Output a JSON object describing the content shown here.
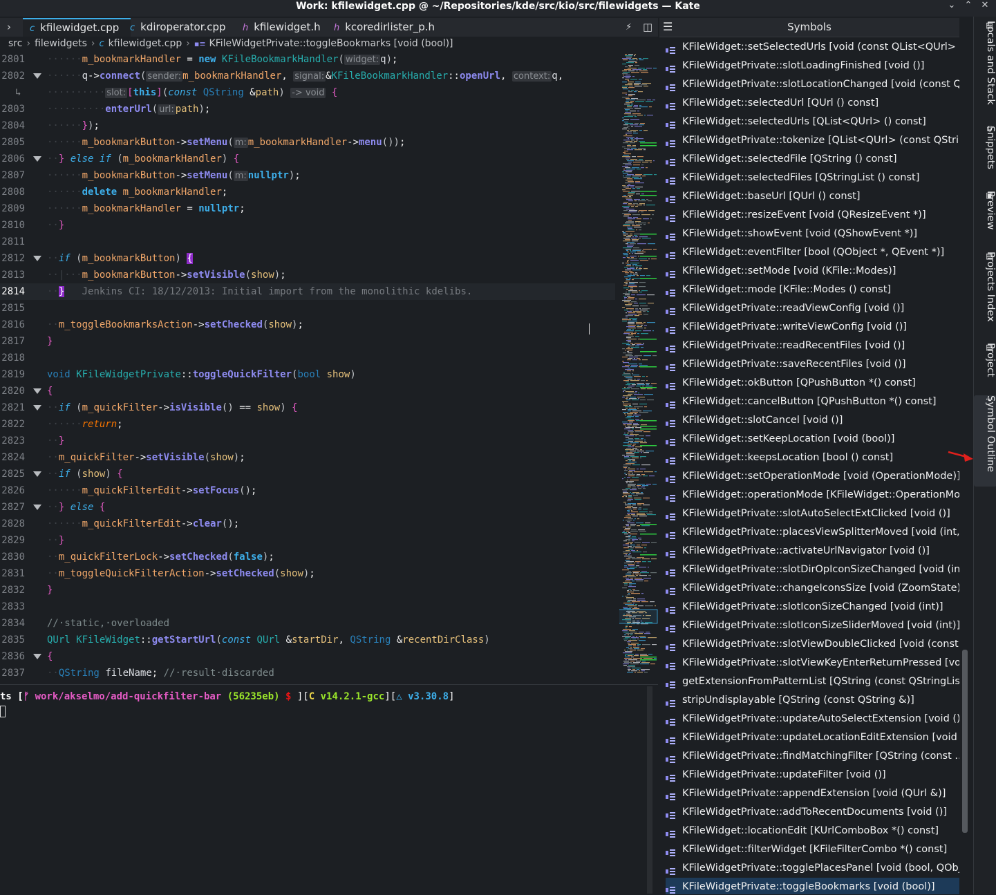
{
  "window": {
    "title": "Work: kfilewidget.cpp @ ~/Repositories/kde/src/kio/src/filewidgets — Kate"
  },
  "tabs": [
    {
      "label": "kfilewidget.cpp",
      "icon": "c-file-icon"
    },
    {
      "label": "kdiroperator.cpp",
      "icon": "c-file-icon"
    },
    {
      "label": "kfilewidget.h",
      "icon": "h-file-icon"
    },
    {
      "label": "kcoredirlister_p.h",
      "icon": "h-file-icon"
    }
  ],
  "breadcrumb": {
    "a": "src",
    "b": "filewidgets",
    "c": "kfilewidget.cpp",
    "d": "KFileWidgetPrivate::toggleBookmarks [void (bool)]"
  },
  "editor": {
    "lines": {
      "l2801": "2801",
      "l2802": "2802",
      "l2803": "2803",
      "l2804": "2804",
      "l2805": "2805",
      "l2806": "2806",
      "l2807": "2807",
      "l2808": "2808",
      "l2809": "2809",
      "l2810": "2810",
      "l2811": "2811",
      "l2812": "2812",
      "l2813": "2813",
      "l2814": "2814",
      "l2815": "2815",
      "l2816": "2816",
      "l2817": "2817",
      "l2818": "2818",
      "l2819": "2819",
      "l2820": "2820",
      "l2821": "2821",
      "l2822": "2822",
      "l2823": "2823",
      "l2824": "2824",
      "l2825": "2825",
      "l2826": "2826",
      "l2827": "2827",
      "l2828": "2828",
      "l2829": "2829",
      "l2830": "2830",
      "l2831": "2831",
      "l2832": "2832",
      "l2833": "2833",
      "l2834": "2834",
      "l2835": "2835",
      "l2836": "2836",
      "l2837": "2837"
    },
    "hints": {
      "widget": "widget:",
      "sender": "sender:",
      "signal": "signal:",
      "context": "context:",
      "slot": "slot:",
      "arrow": "-> void",
      "url": "url:",
      "m": "m:"
    },
    "blame": "Jenkins CI: 18/12/2013: Initial import from the monolithic kdelibs."
  },
  "terminal": {
    "prompt_prefix": "ts [",
    "branch_icon": "ᚠ",
    "branch": "work/akselmo/add-quickfilter-bar",
    "commit": "(56235eb)",
    "dollar": "$",
    "mid1": "][",
    "c_lang": "C",
    "c_version": "v14.2.1-gcc",
    "mid2": "][",
    "delta": "△",
    "cmake_version": "v3.30.8",
    "end": "]"
  },
  "symbols": {
    "title": "Symbols",
    "items": [
      "KFileWidget::setSelectedUrls [void (const QList<QUrl> &)]",
      "KFileWidgetPrivate::slotLoadingFinished [void ()]",
      "KFileWidgetPrivate::slotLocationChanged [void (const Q...",
      "KFileWidget::selectedUrl [QUrl () const]",
      "KFileWidget::selectedUrls [QList<QUrl> () const]",
      "KFileWidgetPrivate::tokenize [QList<QUrl> (const QStrin...",
      "KFileWidget::selectedFile [QString () const]",
      "KFileWidget::selectedFiles [QStringList () const]",
      "KFileWidget::baseUrl [QUrl () const]",
      "KFileWidget::resizeEvent [void (QResizeEvent *)]",
      "KFileWidget::showEvent [void (QShowEvent *)]",
      "KFileWidget::eventFilter [bool (QObject *, QEvent *)]",
      "KFileWidget::setMode [void (KFile::Modes)]",
      "KFileWidget::mode [KFile::Modes () const]",
      "KFileWidgetPrivate::readViewConfig [void ()]",
      "KFileWidgetPrivate::writeViewConfig [void ()]",
      "KFileWidgetPrivate::readRecentFiles [void ()]",
      "KFileWidgetPrivate::saveRecentFiles [void ()]",
      "KFileWidget::okButton [QPushButton *() const]",
      "KFileWidget::cancelButton [QPushButton *() const]",
      "KFileWidget::slotCancel [void ()]",
      "KFileWidget::setKeepLocation [void (bool)]",
      "KFileWidget::keepsLocation [bool () const]",
      "KFileWidget::setOperationMode [void (OperationMode)]",
      "KFileWidget::operationMode [KFileWidget::OperationMo...",
      "KFileWidgetPrivate::slotAutoSelectExtClicked [void ()]",
      "KFileWidgetPrivate::placesViewSplitterMoved [void (int, ...",
      "KFileWidgetPrivate::activateUrlNavigator [void ()]",
      "KFileWidgetPrivate::slotDirOpIconSizeChanged [void (int)]",
      "KFileWidgetPrivate::changeIconsSize [void (ZoomState)]",
      "KFileWidgetPrivate::slotIconSizeChanged [void (int)]",
      "KFileWidgetPrivate::slotIconSizeSliderMoved [void (int)]",
      "KFileWidgetPrivate::slotViewDoubleClicked [void (const ...",
      "KFileWidgetPrivate::slotViewKeyEnterReturnPressed [vo...",
      "getExtensionFromPatternList [QString (const QStringLis...",
      "stripUndisplayable [QString (const QString &)]",
      "KFileWidgetPrivate::updateAutoSelectExtension [void ()]",
      "KFileWidgetPrivate::updateLocationEditExtension [void (...",
      "KFileWidgetPrivate::findMatchingFilter [QString (const ...",
      "KFileWidgetPrivate::updateFilter [void ()]",
      "KFileWidgetPrivate::appendExtension [void (QUrl &)]",
      "KFileWidgetPrivate::addToRecentDocuments [void ()]",
      "KFileWidget::locationEdit [KUrlComboBox *() const]",
      "KFileWidget::filterWidget [KFileFilterCombo *() const]",
      "KFileWidgetPrivate::togglePlacesPanel [void (bool, QObj...",
      "KFileWidgetPrivate::toggleBookmarks [void (bool)]"
    ]
  },
  "sidebar": {
    "locals": "Locals and Stack",
    "snippets": "Snippets",
    "preview": "Preview",
    "projects_index": "Projects Index",
    "project": "Project",
    "symbol_outline": "Symbol Outline"
  },
  "colors": {
    "accent": "#3daee9",
    "selection": "#1d3a58",
    "annotation_arrow": "#e0201c"
  }
}
